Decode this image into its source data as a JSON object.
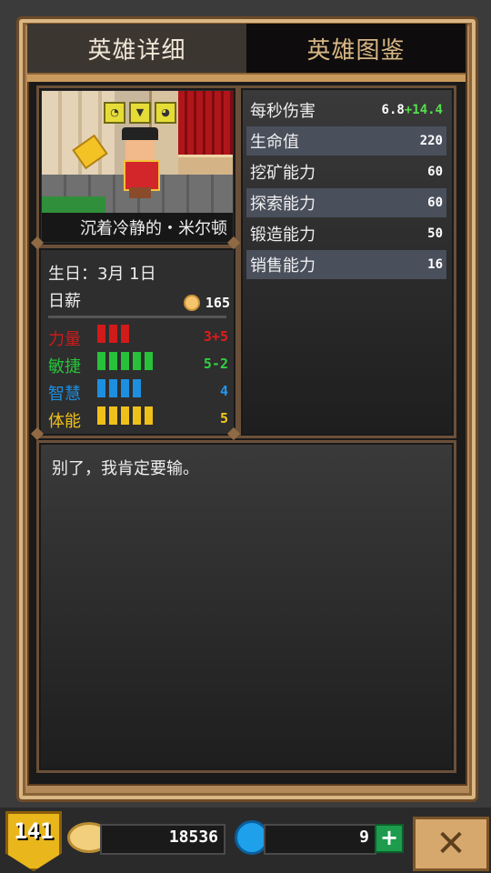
{
  "tabs": {
    "detail": "英雄详细",
    "codex": "英雄图鉴"
  },
  "hero": {
    "name": "沉着冷静的・米尔顿",
    "birthday": "生日：3月 1日",
    "salary_label": "日薪",
    "salary": "165"
  },
  "attributes": [
    {
      "label": "力量",
      "value": "3+5",
      "bars": 3,
      "color": "#d11a1a"
    },
    {
      "label": "敏捷",
      "value": "5-2",
      "bars": 5,
      "color": "#27c23a"
    },
    {
      "label": "智慧",
      "value": "4",
      "bars": 4,
      "color": "#1d8fe0"
    },
    {
      "label": "体能",
      "value": "5",
      "bars": 5,
      "color": "#f0c01a"
    }
  ],
  "stats": [
    {
      "label": "每秒伤害",
      "base": "6.8",
      "bonus": "+14.4"
    },
    {
      "label": "生命值",
      "base": "220",
      "bonus": ""
    },
    {
      "label": "挖矿能力",
      "base": "60",
      "bonus": ""
    },
    {
      "label": "探索能力",
      "base": "60",
      "bonus": ""
    },
    {
      "label": "锻造能力",
      "base": "50",
      "bonus": ""
    },
    {
      "label": "销售能力",
      "base": "16",
      "bonus": ""
    }
  ],
  "quote": "别了，我肯定要输。",
  "resources": {
    "level": "141",
    "gold": "18536",
    "gems": "9"
  }
}
